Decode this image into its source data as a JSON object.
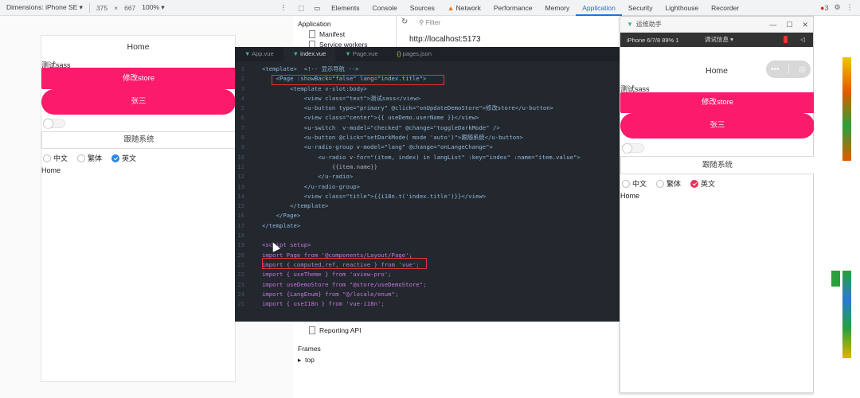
{
  "device_toolbar": {
    "dimensions_label": "Dimensions: iPhone SE",
    "width": "375",
    "times": "×",
    "height": "667",
    "zoom": "100%"
  },
  "devtools": {
    "tabs": [
      "Elements",
      "Console",
      "Sources",
      "Network",
      "Performance",
      "Memory",
      "Application",
      "Security",
      "Lighthouse",
      "Recorder"
    ],
    "active_tab": "Application",
    "error_count": "3",
    "filter_placeholder": "Filter",
    "url": "http://localhost:5173"
  },
  "app_panel": {
    "heading": "Application",
    "items": [
      "Manifest",
      "Service workers"
    ],
    "reporting_api": "Reporting API",
    "frames_heading": "Frames",
    "frames_top": "top"
  },
  "phone_left": {
    "nav_title": "Home",
    "sass_text": "测试sass",
    "button_primary": "修改store",
    "button_center": "张三",
    "follow_system": "跟随系统",
    "radio_options": [
      "中文",
      "繁体",
      "英文"
    ],
    "selected_radio": "英文",
    "bottom_title": "Home"
  },
  "editor": {
    "tabs": [
      "App.vue",
      "index.vue",
      "Page.vue",
      "pages.json"
    ],
    "active_tab": "index.vue",
    "lines": [
      {
        "n": "1",
        "code": "<template>  <!-- 显示导航 -->"
      },
      {
        "n": "2",
        "code": "    <Page :showBack=\"false\" lang=\"index.title\">"
      },
      {
        "n": "3",
        "code": "        <template v-slot:body>"
      },
      {
        "n": "4",
        "code": "            <view class=\"text\">测试sass</view>"
      },
      {
        "n": "5",
        "code": "            <u-button type=\"primary\" @click=\"onUpdateDemoStore\">修改store</u-button>"
      },
      {
        "n": "6",
        "code": "            <view class=\"center\">{{ useDemo.userName }}</view>"
      },
      {
        "n": "7",
        "code": "            <u-switch  v-model=\"checked\" @change=\"toggleDarkMode\" />"
      },
      {
        "n": "8",
        "code": "            <u-button @click=\"setDarkMode( mode 'auto')\">跟随系统</u-button>"
      },
      {
        "n": "9",
        "code": "            <u-radio-group v-model=\"lang\" @change=\"onLangeChange\">"
      },
      {
        "n": "10",
        "code": "                <u-radio v-for=\"(item, index) in langList\" :key=\"index\" :name=\"item.value\">"
      },
      {
        "n": "11",
        "code": "                    {{item.name}}"
      },
      {
        "n": "12",
        "code": "                </u-radio>"
      },
      {
        "n": "13",
        "code": "            </u-radio-group>"
      },
      {
        "n": "14",
        "code": "            <view class=\"title\">{{i18n.t('index.title')}}</view>"
      },
      {
        "n": "15",
        "code": "        </template>"
      },
      {
        "n": "16",
        "code": "    </Page>"
      },
      {
        "n": "17",
        "code": "</template>"
      },
      {
        "n": "18",
        "code": ""
      },
      {
        "n": "19",
        "code": "<script setup>"
      },
      {
        "n": "20",
        "code": "import Page from '@components/Layout/Page';"
      },
      {
        "n": "21",
        "code": "import { computed,ref, reactive } from 'vue';"
      },
      {
        "n": "22",
        "code": "import { useTheme } from 'uview-pro';"
      },
      {
        "n": "23",
        "code": "import useDemoStore from \"@store/useDemoStore\";"
      },
      {
        "n": "24",
        "code": "import {LangEnum} from \"@/locale/enum\";"
      },
      {
        "n": "25",
        "code": "import { useI18n } from 'vue-i18n';"
      }
    ]
  },
  "preview_window": {
    "title": "运维助手",
    "status_device": "iPhone 6/7/8 89% 1",
    "status_mid": "调试信息 ▾",
    "nav_title": "Home",
    "capsule_dots": "•••",
    "sass_text": "测试sass",
    "button_primary": "修改store",
    "button_center": "张三",
    "follow_system": "跟随系统",
    "radio_options": [
      "中文",
      "繁体",
      "英文"
    ],
    "selected_radio": "英文",
    "bottom_title": "Home"
  },
  "colors": {
    "primary_pink": "#fc1a6b",
    "radio_blue": "#2b85e4",
    "highlight_red": "#e0343a",
    "devtools_active": "#1a73e8"
  }
}
